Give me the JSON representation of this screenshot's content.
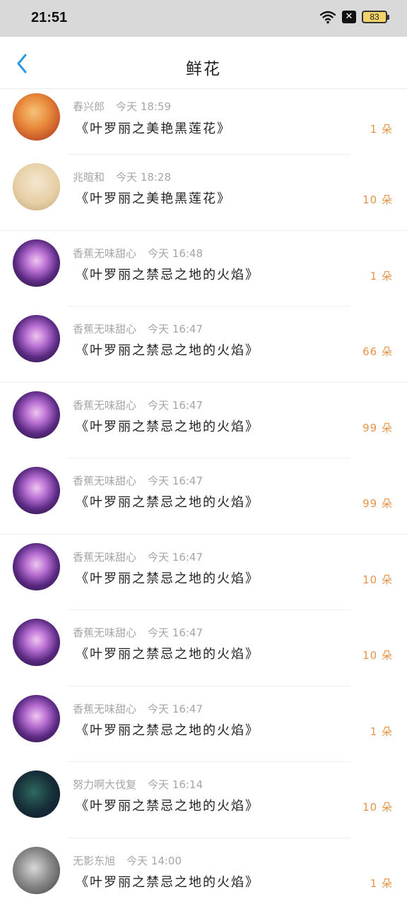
{
  "status_bar": {
    "time": "21:51",
    "battery": "83",
    "x_badge": "✕"
  },
  "nav": {
    "title": "鲜花"
  },
  "items": [
    {
      "name": "春兴郎",
      "time": "今天 18:59",
      "gift": "《叶罗丽之美艳黑莲花》",
      "count": "1 朵",
      "avatar": "avatar-fantasy-warrior"
    },
    {
      "name": "兆暄和",
      "time": "今天 18:28",
      "gift": "《叶罗丽之美艳黑莲花》",
      "count": "10 朵",
      "avatar": "avatar-woman-portrait"
    },
    {
      "name": "香蕉无味甜心",
      "time": "今天 16:48",
      "gift": "《叶罗丽之禁忌之地的火焰》",
      "count": "1 朵",
      "avatar": "avatar-anime-girl"
    },
    {
      "name": "香蕉无味甜心",
      "time": "今天 16:47",
      "gift": "《叶罗丽之禁忌之地的火焰》",
      "count": "66 朵",
      "avatar": "avatar-anime-girl"
    },
    {
      "name": "香蕉无味甜心",
      "time": "今天 16:47",
      "gift": "《叶罗丽之禁忌之地的火焰》",
      "count": "99 朵",
      "avatar": "avatar-anime-girl"
    },
    {
      "name": "香蕉无味甜心",
      "time": "今天 16:47",
      "gift": "《叶罗丽之禁忌之地的火焰》",
      "count": "99 朵",
      "avatar": "avatar-anime-girl"
    },
    {
      "name": "香蕉无味甜心",
      "time": "今天 16:47",
      "gift": "《叶罗丽之禁忌之地的火焰》",
      "count": "10 朵",
      "avatar": "avatar-anime-girl"
    },
    {
      "name": "香蕉无味甜心",
      "time": "今天 16:47",
      "gift": "《叶罗丽之禁忌之地的火焰》",
      "count": "10 朵",
      "avatar": "avatar-anime-girl"
    },
    {
      "name": "香蕉无味甜心",
      "time": "今天 16:47",
      "gift": "《叶罗丽之禁忌之地的火焰》",
      "count": "1 朵",
      "avatar": "avatar-anime-girl"
    },
    {
      "name": "努力啊大伐复",
      "time": "今天 16:14",
      "gift": "《叶罗丽之禁忌之地的火焰》",
      "count": "10 朵",
      "avatar": "avatar-aurora-landscape"
    },
    {
      "name": "无影东旭",
      "time": "今天 14:00",
      "gift": "《叶罗丽之禁忌之地的火焰》",
      "count": "1 朵",
      "avatar": "avatar-grayscale-photo"
    }
  ],
  "colors": {
    "accent": "#e8934a",
    "back_arrow": "#2a9ae0",
    "muted_text": "#a6a6a6"
  }
}
